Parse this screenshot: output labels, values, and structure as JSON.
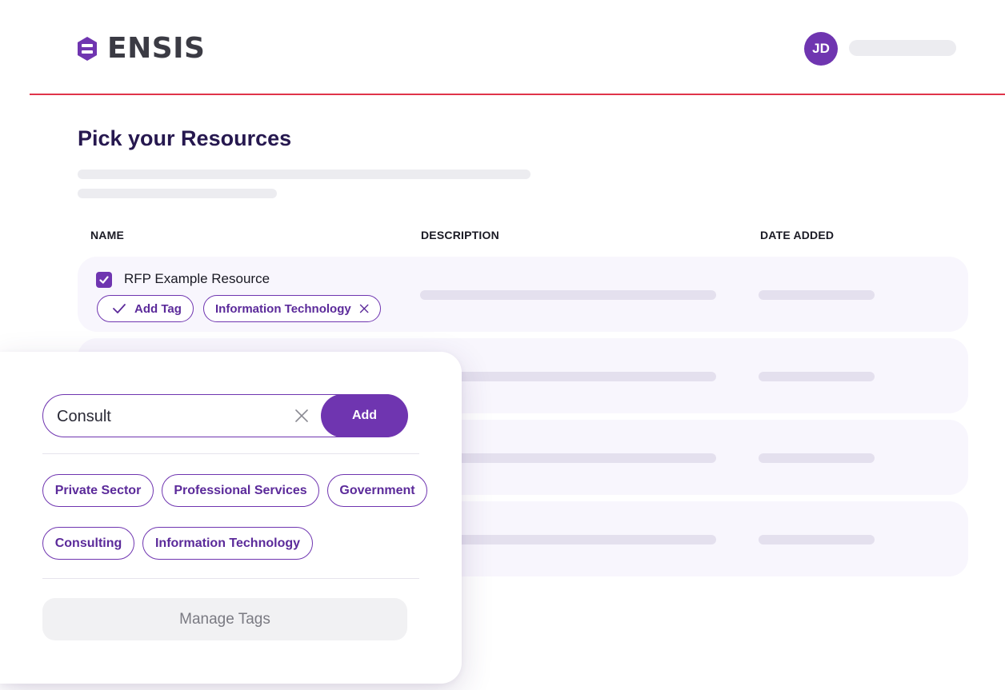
{
  "header": {
    "brand": "ENSIS",
    "avatar_initials": "JD"
  },
  "page": {
    "title": "Pick your Resources"
  },
  "table": {
    "columns": [
      "NAME",
      "DESCRIPTION",
      "DATE ADDED"
    ],
    "rows": [
      {
        "name": "RFP Example Resource",
        "checked": true,
        "tags": [
          {
            "label": "Add Tag",
            "icon": "check-icon"
          },
          {
            "label": "Information Technology",
            "icon": "close-icon"
          }
        ]
      }
    ]
  },
  "tag_popup": {
    "search_value": "Consult",
    "add_label": "Add",
    "tags": [
      "Private Sector",
      "Professional Services",
      "Government",
      "Consulting",
      "Information Technology"
    ],
    "manage_label": "Manage Tags"
  },
  "colors": {
    "accent": "#6f35b0",
    "header_rule": "#e0344a",
    "title": "#26184f"
  }
}
